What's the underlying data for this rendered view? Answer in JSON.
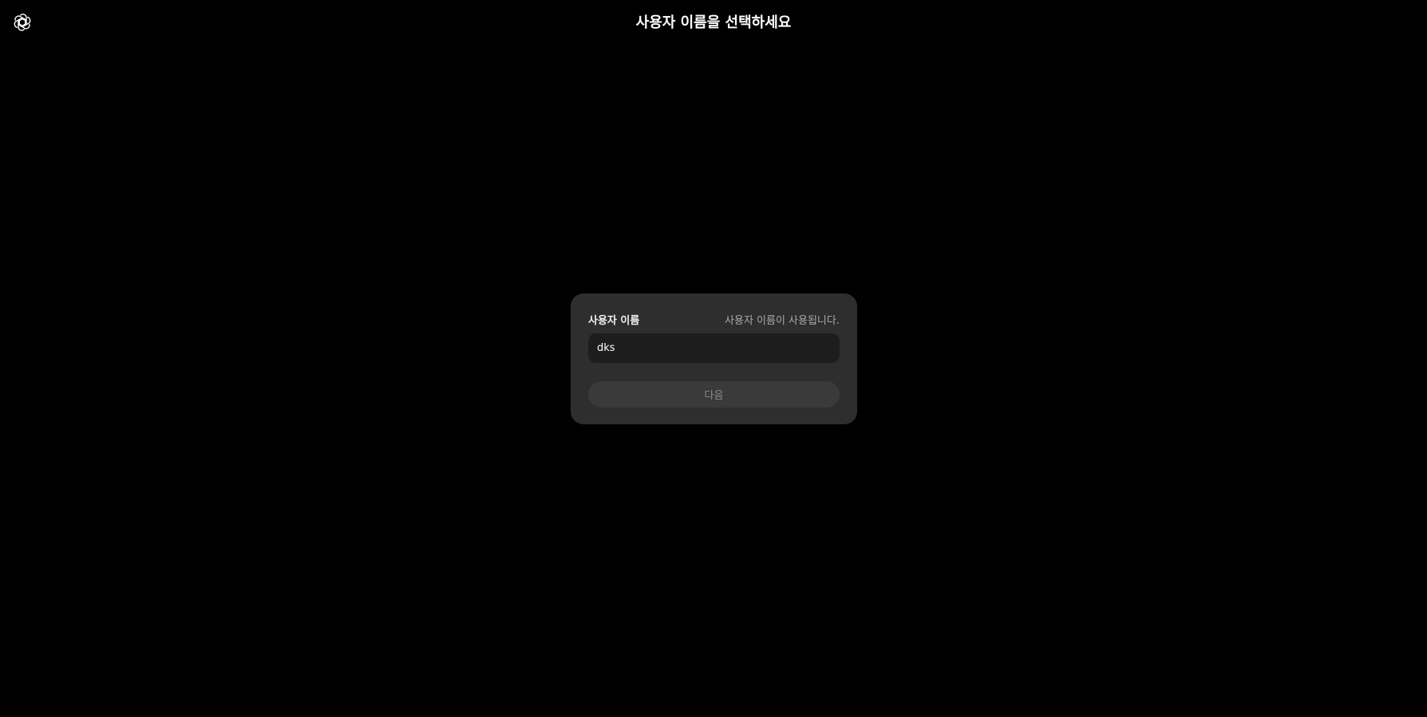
{
  "header": {
    "logo_icon": "openai-logo-icon",
    "title": "사용자 이름을 선택하세요"
  },
  "form": {
    "label": "사용자 이름",
    "hint": "사용자 이름이 사용됩니다.",
    "input_value": "dks",
    "next_label": "다음"
  },
  "colors": {
    "background": "#000000",
    "card": "#2e2e2e",
    "input_bg": "#1d1d1d",
    "button_bg": "#3a3a3a",
    "button_text": "#8a8a8a"
  }
}
